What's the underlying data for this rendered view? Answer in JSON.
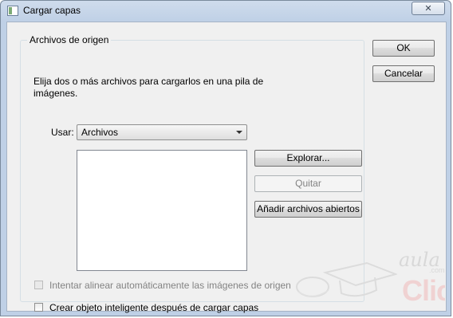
{
  "window": {
    "title": "Cargar capas",
    "close_glyph": "✕"
  },
  "group": {
    "legend": "Archivos de origen",
    "description": "Elija dos o más archivos para cargarlos en una pila de imágenes.",
    "use_label": "Usar:",
    "use_select": {
      "selected": "Archivos",
      "options": [
        "Archivos"
      ]
    },
    "file_list": [],
    "buttons": {
      "browse": "Explorar...",
      "remove": "Quitar",
      "add_open": "Añadir archivos abiertos"
    },
    "checkboxes": {
      "auto_align": {
        "label": "Intentar alinear automáticamente las imágenes de origen",
        "checked": false,
        "enabled": false
      },
      "smart_object": {
        "label": "Crear objeto inteligente después de cargar capas",
        "checked": false,
        "enabled": true
      }
    }
  },
  "dialog_buttons": {
    "ok": "OK",
    "cancel": "Cancelar"
  },
  "watermark": {
    "line1": "aula",
    "line2": ".com",
    "line3": "Clic"
  },
  "colors": {
    "titlebar": "#bfd0e6",
    "client": "#f0f0f0",
    "watermark_red": "#f0d2d2"
  }
}
